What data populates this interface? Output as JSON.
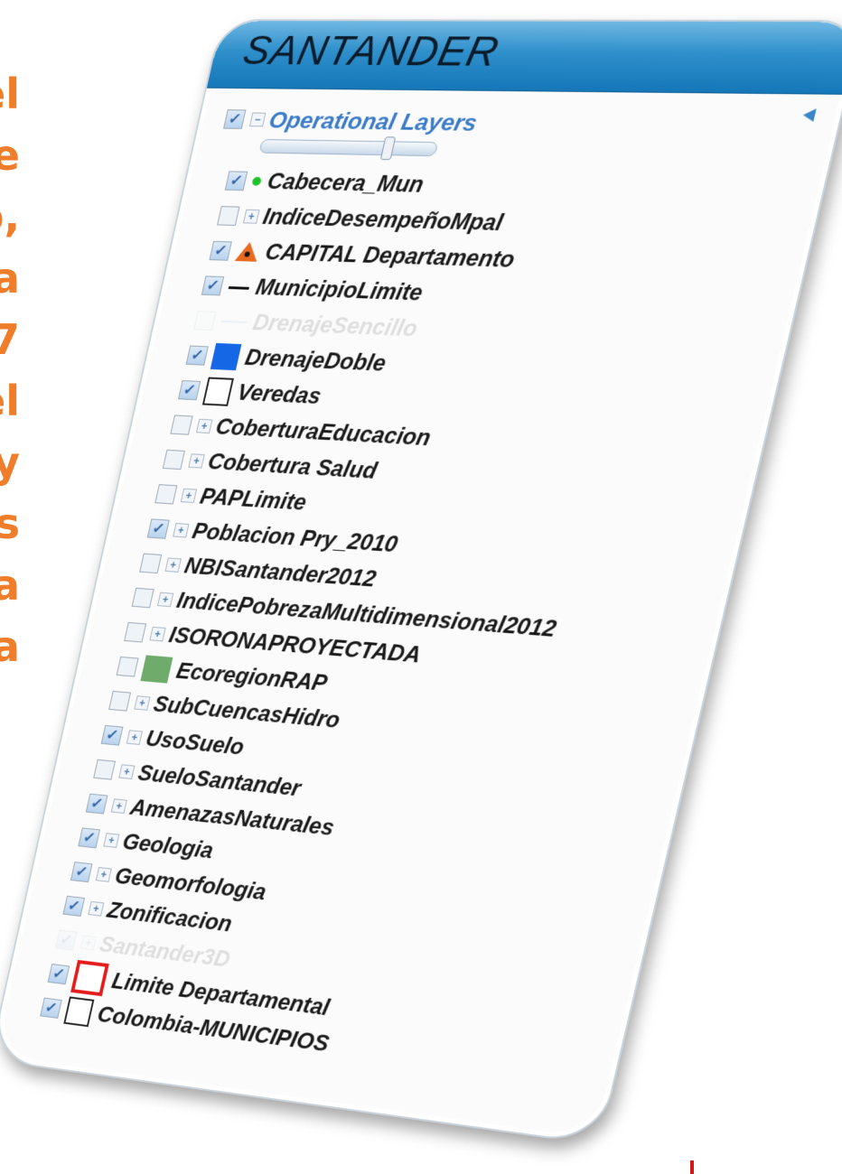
{
  "side_text_lines": [
    "el",
    "e",
    "o,",
    "a",
    "7",
    "el",
    "y",
    "s",
    "a",
    "a"
  ],
  "panel": {
    "title": "SANTANDER",
    "group_label": "Operational Layers",
    "layers": [
      {
        "label": "Cabecera_Mun",
        "checked": true,
        "symbol": "green-dot-icon"
      },
      {
        "label": "IndiceDesempeñoMpal",
        "checked": false,
        "symbol": "expand-icon"
      },
      {
        "label": "CAPITAL Departamento",
        "checked": true,
        "symbol": "orange-triangle-icon"
      },
      {
        "label": "MunicipioLimite",
        "checked": true,
        "symbol": "dash-line-icon"
      },
      {
        "label": "DrenajeSencillo",
        "checked": false,
        "symbol": "blue-line-icon",
        "faded": true
      },
      {
        "label": "DrenajeDoble",
        "checked": true,
        "symbol": "blue-square-icon"
      },
      {
        "label": "Veredas",
        "checked": true,
        "symbol": "hollow-square-icon"
      },
      {
        "label": "CoberturaEducacion",
        "checked": false,
        "symbol": "expand-icon"
      },
      {
        "label": "Cobertura Salud",
        "checked": false,
        "symbol": "expand-icon"
      },
      {
        "label": "PAPLimite",
        "checked": false,
        "symbol": "expand-icon"
      },
      {
        "label": "Poblacion Pry_2010",
        "checked": true,
        "symbol": "expand-icon"
      },
      {
        "label": "NBISantander2012",
        "checked": false,
        "symbol": "expand-icon"
      },
      {
        "label": "IndicePobrezaMultidimensional2012",
        "checked": false,
        "symbol": "expand-icon"
      },
      {
        "label": "ISORONAPROYECTADA",
        "checked": false,
        "symbol": "expand-icon"
      },
      {
        "label": "EcoregionRAP",
        "checked": false,
        "symbol": "green-square-icon"
      },
      {
        "label": "SubCuencasHidro",
        "checked": false,
        "symbol": "expand-icon"
      },
      {
        "label": "UsoSuelo",
        "checked": true,
        "symbol": "expand-icon"
      },
      {
        "label": "SueloSantander",
        "checked": false,
        "symbol": "expand-icon"
      },
      {
        "label": "AmenazasNaturales",
        "checked": true,
        "symbol": "expand-icon"
      },
      {
        "label": "Geologia",
        "checked": true,
        "symbol": "expand-icon"
      },
      {
        "label": "Geomorfologia",
        "checked": true,
        "symbol": "expand-icon"
      },
      {
        "label": "Zonificacion",
        "checked": true,
        "symbol": "expand-icon"
      },
      {
        "label": "Santander3D",
        "checked": true,
        "symbol": "expand-icon",
        "faded": true
      },
      {
        "label": "Limite Departamental",
        "checked": true,
        "symbol": "red-square-icon"
      },
      {
        "label": "Colombia-MUNICIPIOS",
        "checked": true,
        "symbol": "hollow-square-icon"
      }
    ]
  },
  "colors": {
    "accent_text": "#ef7d2a",
    "header_blue": "#1577b8",
    "group_blue": "#3a7bc8"
  }
}
